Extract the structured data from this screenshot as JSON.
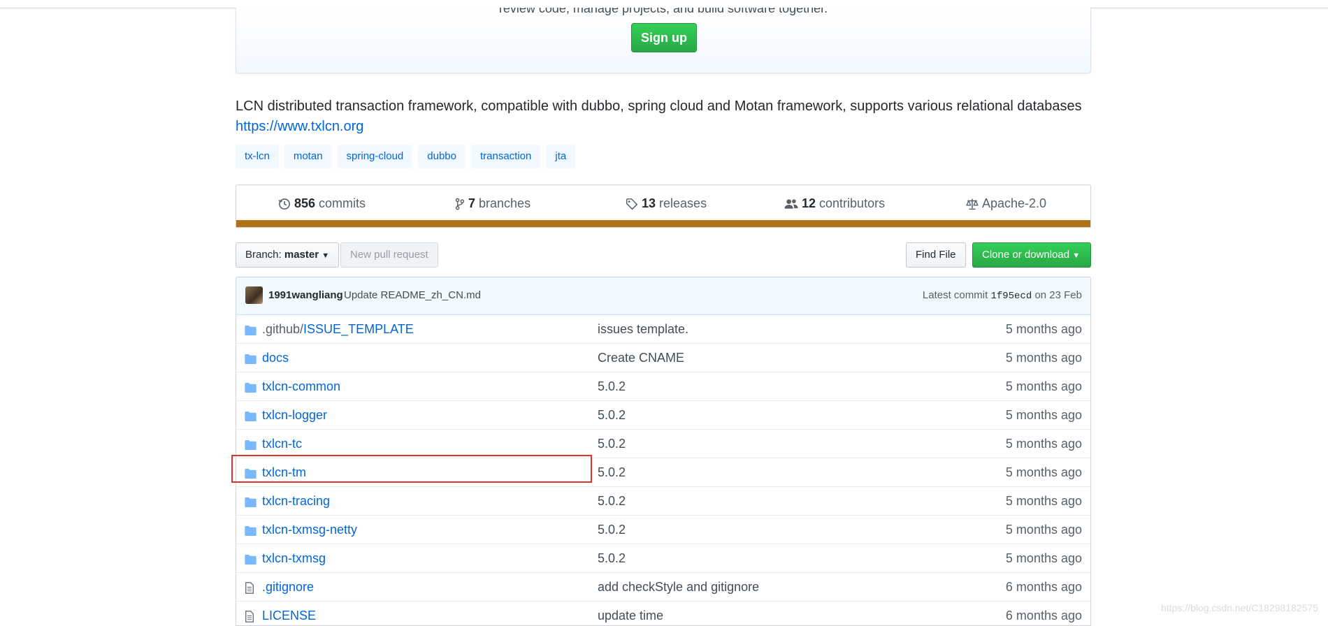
{
  "jumbotron": {
    "tagline": "review code, manage projects, and build software together.",
    "signup_label": "Sign up"
  },
  "repo": {
    "description": "LCN distributed transaction framework, compatible with dubbo, spring cloud and Motan framework, supports various relational databases",
    "homepage": "https://www.txlcn.org",
    "topics": [
      "tx-lcn",
      "motan",
      "spring-cloud",
      "dubbo",
      "transaction",
      "jta"
    ]
  },
  "summary": {
    "commits": {
      "count": "856",
      "label": "commits"
    },
    "branches": {
      "count": "7",
      "label": "branches"
    },
    "releases": {
      "count": "13",
      "label": "releases"
    },
    "contributors": {
      "count": "12",
      "label": "contributors"
    },
    "license": "Apache-2.0",
    "language_color": "#b07219"
  },
  "toolbar": {
    "branch_prefix": "Branch:",
    "branch_name": "master",
    "new_pr_label": "New pull request",
    "find_file_label": "Find File",
    "clone_label": "Clone or download"
  },
  "latest_commit": {
    "author": "1991wangliang",
    "message": "Update README_zh_CN.md",
    "prefix": "Latest commit",
    "sha": "1f95ecd",
    "date": "on 23 Feb"
  },
  "files": [
    {
      "type": "dir",
      "prefix": ".github/",
      "name": "ISSUE_TEMPLATE",
      "message": "issues template.",
      "age": "5 months ago"
    },
    {
      "type": "dir",
      "prefix": "",
      "name": "docs",
      "message": "Create CNAME",
      "age": "5 months ago"
    },
    {
      "type": "dir",
      "prefix": "",
      "name": "txlcn-common",
      "message": "5.0.2",
      "age": "5 months ago"
    },
    {
      "type": "dir",
      "prefix": "",
      "name": "txlcn-logger",
      "message": "5.0.2",
      "age": "5 months ago"
    },
    {
      "type": "dir",
      "prefix": "",
      "name": "txlcn-tc",
      "message": "5.0.2",
      "age": "5 months ago"
    },
    {
      "type": "dir",
      "prefix": "",
      "name": "txlcn-tm",
      "message": "5.0.2",
      "age": "5 months ago"
    },
    {
      "type": "dir",
      "prefix": "",
      "name": "txlcn-tracing",
      "message": "5.0.2",
      "age": "5 months ago"
    },
    {
      "type": "dir",
      "prefix": "",
      "name": "txlcn-txmsg-netty",
      "message": "5.0.2",
      "age": "5 months ago"
    },
    {
      "type": "dir",
      "prefix": "",
      "name": "txlcn-txmsg",
      "message": "5.0.2",
      "age": "5 months ago"
    },
    {
      "type": "file",
      "prefix": "",
      "name": ".gitignore",
      "message": "add checkStyle and gitignore",
      "age": "6 months ago"
    },
    {
      "type": "file",
      "prefix": "",
      "name": "LICENSE",
      "message": "update time",
      "age": "6 months ago"
    }
  ],
  "watermark": "https://blog.csdn.net/C18298182575",
  "icons": {
    "folder": "folder-icon",
    "file": "file-icon"
  }
}
